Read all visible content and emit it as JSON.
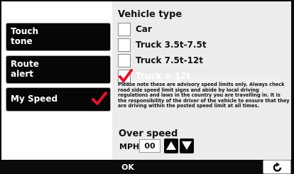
{
  "sidebar": {
    "items": [
      {
        "label_line1": "Touch",
        "label_line2": "tone"
      },
      {
        "label_line1": "Route",
        "label_line2": "alert"
      },
      {
        "label": "My Speed"
      }
    ]
  },
  "vehicle": {
    "title": "Vehicle type",
    "options": [
      "Car",
      "Truck 3.5t-7.5t",
      "Truck 7.5t-12t",
      "Truck > 12t"
    ],
    "selected": "Truck > 12t"
  },
  "notice": "Please note these are advisory speed limits only. Always check road side speed limit signs and abide by local driving regulations and laws in the country you are travelling in. It is the responsibility of the driver of the vehicle to ensure  that they are driving within the posted speed limit at all times.",
  "over_speed": {
    "title": "Over speed",
    "unit": "MPH",
    "value": "00"
  },
  "footer": {
    "ok_label": "OK"
  },
  "colors": {
    "check_red": "#e8102a",
    "button_black": "#060606"
  },
  "icons": {
    "check": "red-checkmark-icon",
    "up": "up-arrow-icon",
    "down": "down-arrow-icon",
    "back": "back-arrow-icon"
  }
}
